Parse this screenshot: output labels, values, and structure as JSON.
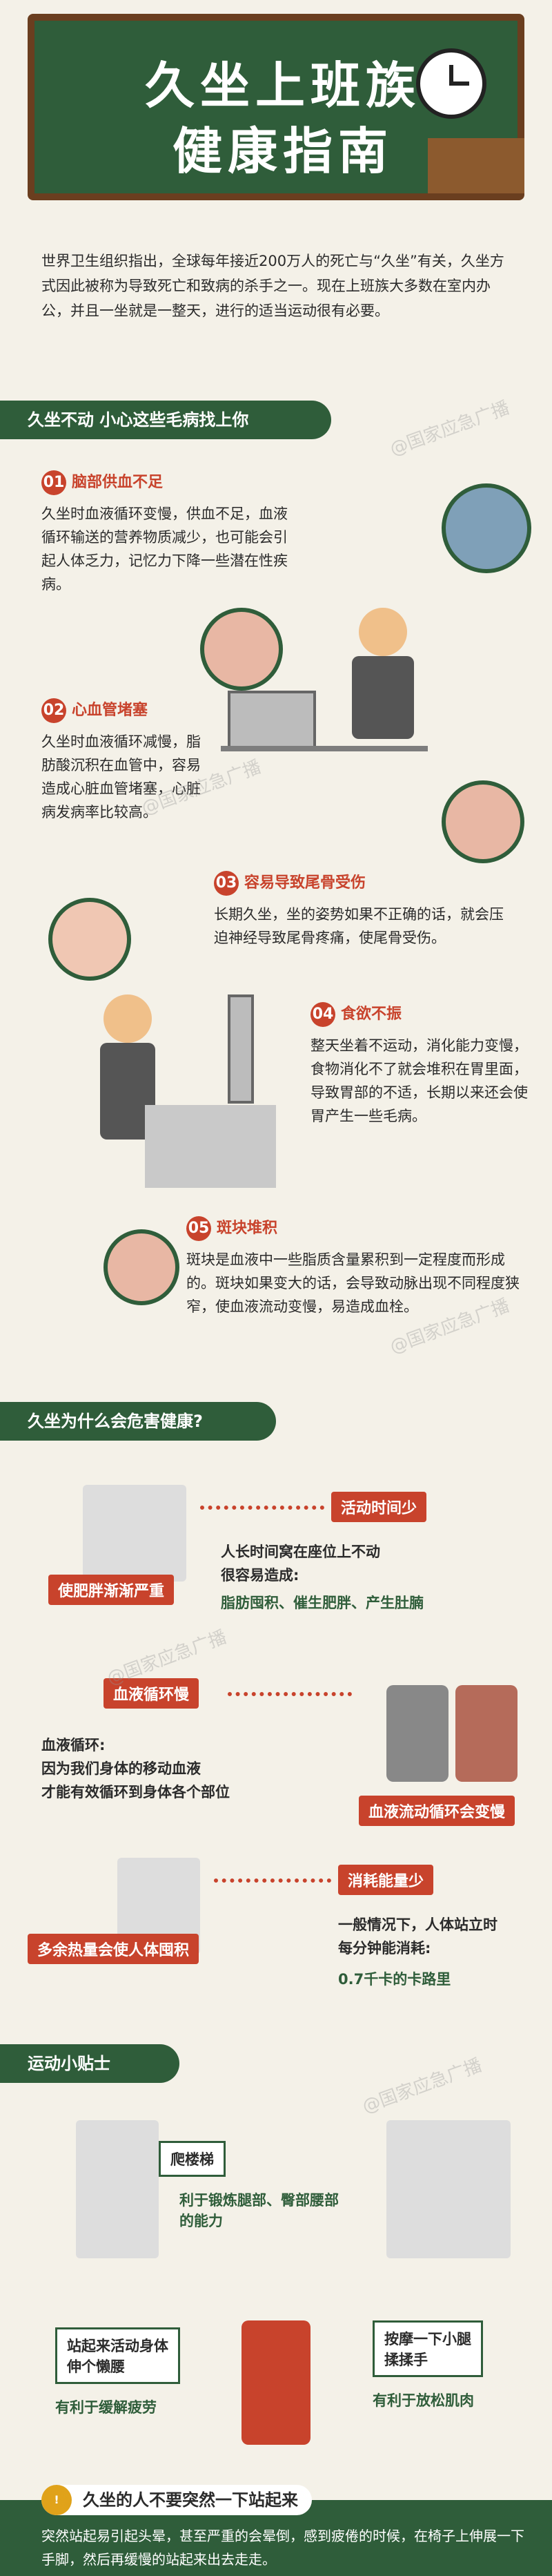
{
  "hero": {
    "title_line1": "久坐上班族",
    "title_line2": "健康指南"
  },
  "intro": "世界卫生组织指出，全球每年接近200万人的死亡与“久坐”有关，久坐方式因此被称为导致死亡和致病的杀手之一。现在上班族大多数在室内办公，并且一坐就是一整天，进行的适当运动很有必要。",
  "section1": {
    "banner": "久坐不动 小心这些毛病找上你",
    "items": [
      {
        "num": "01",
        "title": "脑部供血不足",
        "text": "久坐时血液循环变慢，供血不足，血液循环输送的营养物质减少，也可能会引起人体乏力，记忆力下降一些潜在性疾病。"
      },
      {
        "num": "02",
        "title": "心血管堵塞",
        "text": "久坐时血液循环减慢，脂肪酸沉积在血管中，容易造成心脏血管堵塞，心脏病发病率比较高。"
      },
      {
        "num": "03",
        "title": "容易导致尾骨受伤",
        "text": "长期久坐，坐的姿势如果不正确的话，就会压迫神经导致尾骨疼痛，使尾骨受伤。"
      },
      {
        "num": "04",
        "title": "食欲不振",
        "text": "整天坐着不运动，消化能力变慢，食物消化不了就会堆积在胃里面，导致胃部的不适，长期以来还会使胃产生一些毛病。"
      },
      {
        "num": "05",
        "title": "斑块堆积",
        "text": "斑块是血液中一些脂质含量累积到一定程度而形成的。斑块如果变大的话，会导致动脉出现不同程度狭窄，使血液流动变慢，易造成血栓。"
      }
    ]
  },
  "section2": {
    "banner": "久坐为什么会危害健康?",
    "r1": {
      "tag": "活动时间少",
      "tag2": "使肥胖渐渐严重",
      "text": "人长时间窝在座位上不动\n很容易造成:",
      "text2": "脂肪囤积、催生肥胖、产生肚腩"
    },
    "r2": {
      "tag": "血液循环慢",
      "tag2": "血液流动循环会变慢",
      "text": "血液循环:\n因为我们身体的移动血液\n才能有效循环到身体各个部位"
    },
    "r3": {
      "tag": "消耗能量少",
      "tag2": "多余热量会使人体囤积",
      "text": "一般情况下，人体站立时\n每分钟能消耗:",
      "text2": "0.7千卡的卡路里"
    }
  },
  "section3": {
    "banner": "运动小贴士",
    "t1": {
      "label": "爬楼梯",
      "text": "利于锻炼腿部、臀部腰部的能力"
    },
    "t2": {
      "label": "按摩一下小腿\n揉揉手",
      "text": "有利于放松肌肉"
    },
    "t3": {
      "label": "站起来活动身体\n伸个懒腰",
      "text": "有利于缓解疲劳"
    }
  },
  "footer": {
    "warn": "久坐的人不要突然一下站起来",
    "icon": "!",
    "text": "突然站起易引起头晕，甚至严重的会晕倒，感到疲倦的时候，在椅子上伸展一下手脚，然后再缓慢的站起来出去走走。"
  },
  "watermark": "@国家应急广播"
}
